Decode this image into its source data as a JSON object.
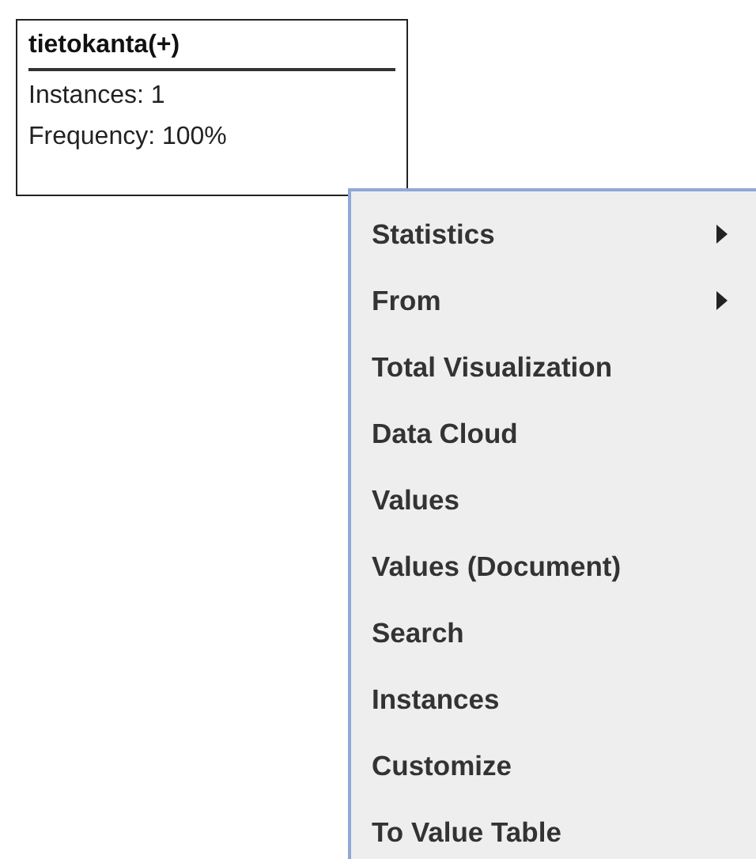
{
  "node": {
    "title": "tietokanta(+)",
    "lines": [
      "Instances: 1",
      "Frequency: 100%"
    ]
  },
  "menu": {
    "items": [
      {
        "label": "Statistics",
        "submenu": true
      },
      {
        "label": "From",
        "submenu": true
      },
      {
        "label": "Total Visualization",
        "submenu": false
      },
      {
        "label": "Data Cloud",
        "submenu": false
      },
      {
        "label": "Values",
        "submenu": false
      },
      {
        "label": "Values (Document)",
        "submenu": false
      },
      {
        "label": "Search",
        "submenu": false
      },
      {
        "label": "Instances",
        "submenu": false
      },
      {
        "label": "Customize",
        "submenu": false
      },
      {
        "label": "To Value Table",
        "submenu": false
      }
    ]
  }
}
